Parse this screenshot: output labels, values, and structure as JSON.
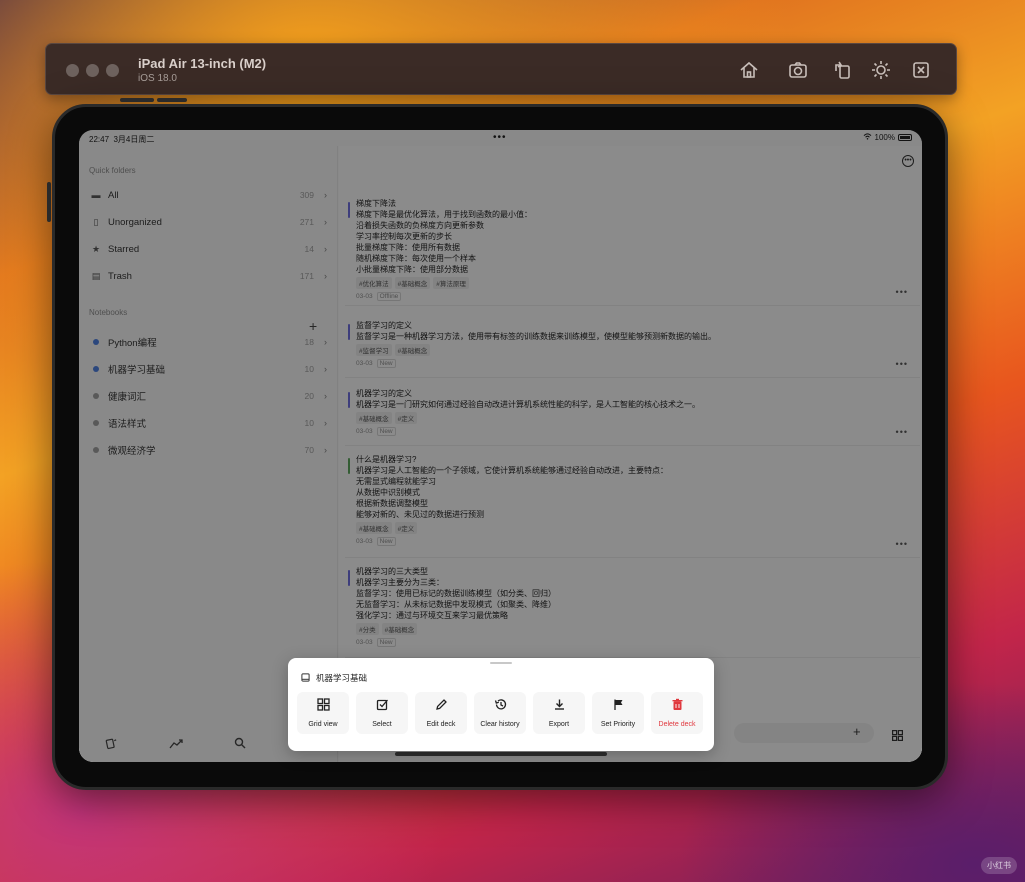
{
  "simulator": {
    "device_name": "iPad Air 13-inch (M2)",
    "os_version": "iOS 18.0",
    "toolbar_icons": [
      "home-icon",
      "screenshot-icon",
      "rotate-icon",
      "brightness-icon",
      "keyboard-icon"
    ]
  },
  "status_bar": {
    "time": "22:47",
    "date": "3月4日周二",
    "battery": "100%"
  },
  "sidebar": {
    "quick_folders_label": "Quick folders",
    "quick_folders": [
      {
        "label": "All",
        "count": "309",
        "icon": "folder-icon"
      },
      {
        "label": "Unorganized",
        "count": "271",
        "icon": "document-icon"
      },
      {
        "label": "Starred",
        "count": "14",
        "icon": "star-icon"
      },
      {
        "label": "Trash",
        "count": "171",
        "icon": "trash-icon"
      }
    ],
    "notebooks_label": "Notebooks",
    "notebooks": [
      {
        "label": "Python编程",
        "count": "18",
        "color": "#4a7bd8"
      },
      {
        "label": "机器学习基础",
        "count": "10",
        "color": "#4a7bd8"
      },
      {
        "label": "健康词汇",
        "count": "20",
        "color": "#999999"
      },
      {
        "label": "语法样式",
        "count": "10",
        "color": "#999999"
      },
      {
        "label": "微观经济学",
        "count": "70",
        "color": "#999999"
      }
    ],
    "bottom_icons": [
      "review-icon",
      "stats-icon",
      "search-icon"
    ]
  },
  "cards": [
    {
      "bar_color": "#6a6ad6",
      "lines": [
        "梯度下降法",
        "梯度下降是最优化算法，用于找到函数的最小值：",
        "沿着损失函数的负梯度方向更新参数",
        "学习率控制每次更新的步长",
        "批量梯度下降：使用所有数据",
        "随机梯度下降：每次使用一个样本",
        "小批量梯度下降：使用部分数据"
      ],
      "tags": [
        "#优化算法",
        "#基础概念",
        "#算法原理"
      ],
      "date": "03-03",
      "status": "Offline"
    },
    {
      "bar_color": "#6a6ad6",
      "lines": [
        "监督学习的定义",
        "监督学习是一种机器学习方法，使用带有标签的训练数据来训练模型，使模型能够预测新数据的输出。"
      ],
      "tags": [
        "#监督学习",
        "#基础概念"
      ],
      "date": "03-03",
      "status": "New"
    },
    {
      "bar_color": "#6a6ad6",
      "lines": [
        "机器学习的定义",
        "机器学习是一门研究如何通过经验自动改进计算机系统性能的科学，是人工智能的核心技术之一。"
      ],
      "tags": [
        "#基础概念",
        "#定义"
      ],
      "date": "03-03",
      "status": "New"
    },
    {
      "bar_color": "#5aa05a",
      "lines": [
        "什么是机器学习?",
        "机器学习是人工智能的一个子领域，它使计算机系统能够通过经验自动改进，主要特点：",
        "无需显式编程就能学习",
        "从数据中识别模式",
        "根据新数据调整模型",
        "能够对新的、未见过的数据进行预测"
      ],
      "tags": [
        "#基础概念",
        "#定义"
      ],
      "date": "03-03",
      "status": "New"
    },
    {
      "bar_color": "#6a6ad6",
      "lines": [
        "机器学习的三大类型",
        "机器学习主要分为三类：",
        "监督学习：使用已标记的数据训练模型（如分类、回归）",
        "无监督学习：从未标记数据中发现模式（如聚类、降维）",
        "强化学习：通过与环境交互来学习最优策略"
      ],
      "tags": [
        "#分类",
        "#基础概念"
      ],
      "date": "03-03",
      "status": "New"
    }
  ],
  "sheet": {
    "title": "机器学习基础",
    "actions": [
      {
        "label": "Grid view",
        "icon": "grid-icon"
      },
      {
        "label": "Select",
        "icon": "checkbox-icon"
      },
      {
        "label": "Edit deck",
        "icon": "pencil-icon"
      },
      {
        "label": "Clear history",
        "icon": "history-icon"
      },
      {
        "label": "Export",
        "icon": "download-icon"
      },
      {
        "label": "Set Priority",
        "icon": "flag-icon"
      },
      {
        "label": "Delete deck",
        "icon": "trash-icon",
        "color": "#e0383e"
      }
    ]
  },
  "watermark": "小红书"
}
